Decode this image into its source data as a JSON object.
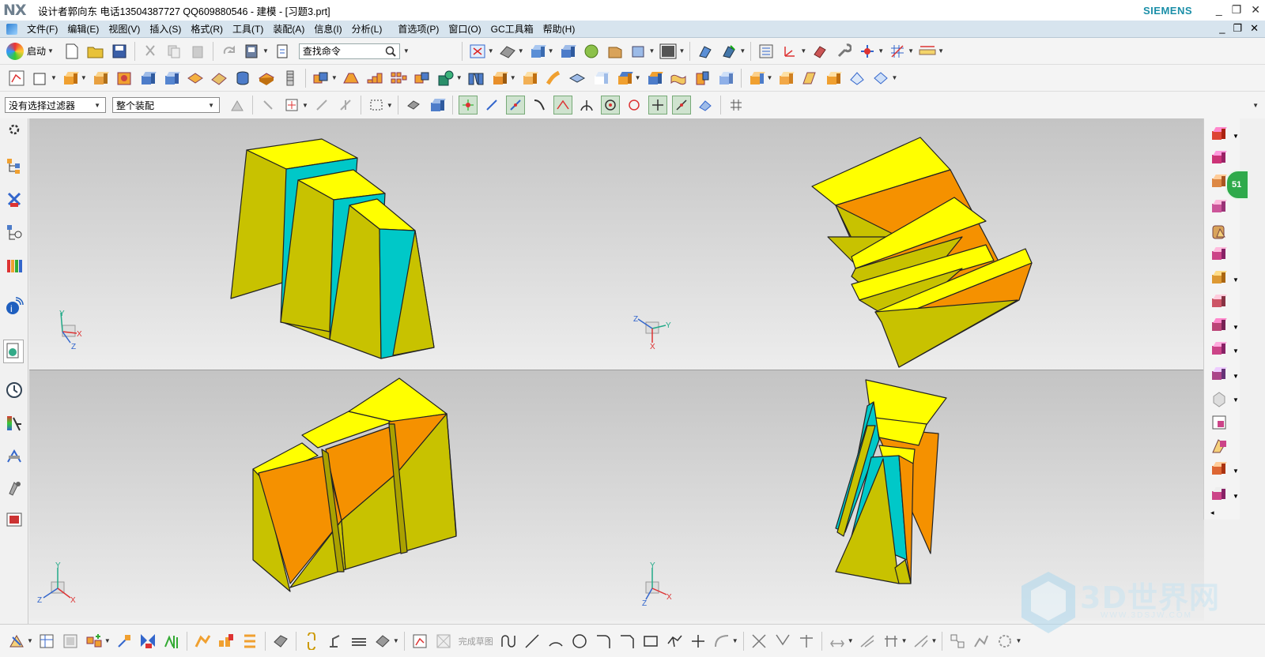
{
  "titlebar": {
    "logo": "NX",
    "title": "设计者郭向东  电话13504387727  QQ609880546 - 建模 - [习题3.prt]",
    "brand": "SIEMENS",
    "buttons": [
      "_",
      "❐",
      "✕"
    ]
  },
  "menubar": {
    "items": [
      "文件(F)",
      "编辑(E)",
      "视图(V)",
      "插入(S)",
      "格式(R)",
      "工具(T)",
      "装配(A)",
      "信息(I)",
      "分析(L)",
      "首选项(P)",
      "窗口(O)",
      "GC工具箱",
      "帮助(H)"
    ],
    "window_buttons": [
      "_",
      "❐",
      "✕"
    ]
  },
  "toolbar1": {
    "start_label": "启动",
    "search_placeholder": "查找命令"
  },
  "toolbar3": {
    "filter_select": "没有选择过滤器",
    "scope_select": "整个装配"
  },
  "bottombar": {
    "finish_sketch_label": "完成草图"
  },
  "badge": {
    "value": "51"
  },
  "watermark": {
    "text": "3D世界网",
    "url": "WWW.3DSJW.COM"
  },
  "colors": {
    "yellow_face": "#ffff00",
    "dark_yellow_face": "#c8c200",
    "cyan_face": "#00c8c8",
    "orange_face": "#f59100",
    "menubar_bg": "#d7e4ee",
    "siemens_teal": "#1b8fa8"
  },
  "viewports": [
    {
      "name": "top-left",
      "triad": [
        "Y",
        "X",
        "Z"
      ]
    },
    {
      "name": "top-right",
      "triad": [
        "Z",
        "Y",
        "X"
      ]
    },
    {
      "name": "bottom-left",
      "triad": [
        "Y",
        "Z",
        "X"
      ]
    },
    {
      "name": "bottom-right",
      "triad": [
        "Y",
        "Z",
        "X"
      ]
    }
  ]
}
